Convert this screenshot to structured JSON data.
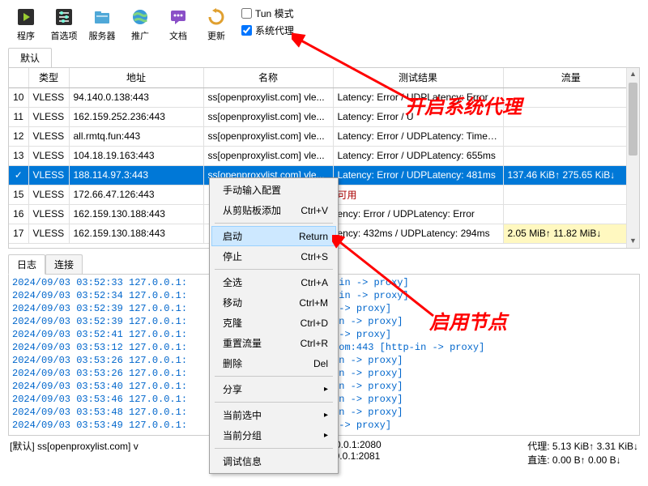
{
  "toolbar": {
    "program": "程序",
    "preferences": "首选项",
    "servers": "服务器",
    "promote": "推广",
    "docs": "文档",
    "update": "更新",
    "tun_label": "Tun 模式",
    "sysproxy_label": "系统代理"
  },
  "main_tab": "默认",
  "columns": {
    "idx": "",
    "type": "类型",
    "addr": "地址",
    "name": "名称",
    "test": "测试结果",
    "traffic": "流量"
  },
  "rows": [
    {
      "idx": "10",
      "type": "VLESS",
      "addr": "94.140.0.138:443",
      "name": "ss[openproxylist.com] vle...",
      "test": "Latency: Error / UDPLatency: Error",
      "traffic": ""
    },
    {
      "idx": "11",
      "type": "VLESS",
      "addr": "162.159.252.236:443",
      "name": "ss[openproxylist.com] vle...",
      "test": "Latency: Error / U",
      "traffic": ""
    },
    {
      "idx": "12",
      "type": "VLESS",
      "addr": "all.rmtq.fun:443",
      "name": "ss[openproxylist.com] vle...",
      "test": "Latency: Error / UDPLatency: Timeout",
      "traffic": ""
    },
    {
      "idx": "13",
      "type": "VLESS",
      "addr": "104.18.19.163:443",
      "name": "ss[openproxylist.com] vle...",
      "test": "Latency: Error / UDPLatency: 655ms",
      "traffic": ""
    },
    {
      "idx": "✓",
      "type": "VLESS",
      "addr": "188.114.97.3:443",
      "name": "ss[openproxylist.com] vle...",
      "test": "Latency: Error / UDPLatency: 481ms",
      "traffic": "137.46 KiB↑ 275.65 KiB↓",
      "sel": true
    },
    {
      "idx": "15",
      "type": "VLESS",
      "addr": "172.66.47.126:443",
      "name": "",
      "test": "可用",
      "traffic": "",
      "red": true
    },
    {
      "idx": "16",
      "type": "VLESS",
      "addr": "162.159.130.188:443",
      "name": "",
      "test": "ency: Error / UDPLatency: Error",
      "traffic": ""
    },
    {
      "idx": "17",
      "type": "VLESS",
      "addr": "162.159.130.188:443",
      "name": "",
      "test": "ency: 432ms / UDPLatency: 294ms",
      "traffic": "2.05 MiB↑ 11.82 MiB↓",
      "ylw": true
    }
  ],
  "ctx": {
    "manual": "手动输入配置",
    "paste": "从剪贴板添加",
    "paste_k": "Ctrl+V",
    "start": "启动",
    "start_k": "Return",
    "stop": "停止",
    "stop_k": "Ctrl+S",
    "selall": "全选",
    "selall_k": "Ctrl+A",
    "move": "移动",
    "move_k": "Ctrl+M",
    "clone": "克隆",
    "clone_k": "Ctrl+D",
    "reset": "重置流量",
    "reset_k": "Ctrl+R",
    "del": "删除",
    "del_k": "Del",
    "share": "分享",
    "cursel": "当前选中",
    "curgrp": "当前分组",
    "debug": "调试信息"
  },
  "log_tabs": {
    "log": "日志",
    "conn": "连接"
  },
  "log_lines": [
    "2024/09/03 03:52:33 127.0.0.1:           ncr.org/ [http-in -> proxy]",
    "2024/09/03 03:52:34 127.0.0.1:           ncr.org/ [http-in -> proxy]",
    "2024/09/03 03:52:39 127.0.0.1:           o:443 [http-in -> proxy]",
    "2024/09/03 03:52:39 127.0.0.1:           com:443 [http-in -> proxy]",
    "2024/09/03 03:52:41 127.0.0.1:           o:443 [http-in -> proxy]",
    "2024/09/03 03:53:12 127.0.0.1:           es.googleapis.com:443 [http-in -> proxy]",
    "2024/09/03 03:53:26 127.0.0.1:           org:443 [http-in -> proxy]",
    "2024/09/03 03:53:26 127.0.0.1:           org:443 [http-in -> proxy]",
    "2024/09/03 03:53:40 127.0.0.1:           org:443 [http-in -> proxy]",
    "2024/09/03 03:53:46 127.0.0.1:           org:443 [http-in -> proxy]",
    "2024/09/03 03:53:48 127.0.0.1:           org:443 [http-in -> proxy]",
    "2024/09/03 03:53:49 127.0.0.1:           o:443 [http-in -> proxy]"
  ],
  "status": {
    "left": "[默认] ss[openproxylist.com] v",
    "socks": "Socks: 127.0.0.1:2080",
    "http": "HTTP: 127.0.0.1:2081",
    "proxy": "代理: 5.13 KiB↑ 3.31 KiB↓",
    "direct": "直连: 0.00 B↑ 0.00 B↓"
  },
  "annotations": {
    "a1": "开启系统代理",
    "a2": "启用节点"
  }
}
